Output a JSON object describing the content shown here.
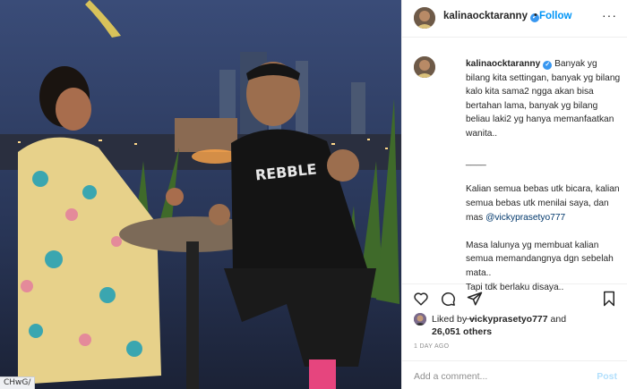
{
  "post": {
    "username": "kalinaocktaranny",
    "separator": "•",
    "follow_label": "Follow",
    "more_icon": "more-options-icon",
    "status_url": "CHwG/"
  },
  "caption": {
    "username": "kalinaocktaranny",
    "lines": [
      "Banyak yg bilang kita settingan, banyak yg bilang kalo kita sama2 ngga akan bisa bertahan lama, banyak yg bilang beliau laki2 yg hanya memanfaatkan wanita..",
      "____",
      "Kalian semua bebas utk bicara, kalian semua bebas utk menilai saya, dan mas",
      "@vickyprasetyo777",
      "Masa lalunya yg membuat kalian semua memandangnya dgn sebelah mata..",
      "Tapi tdk berlaku disaya..",
      "__"
    ]
  },
  "actions": {
    "icons": [
      "heart-icon",
      "comment-icon",
      "share-icon",
      "bookmark-icon"
    ]
  },
  "likes": {
    "prefix": "Liked by",
    "user": "vickyprasetyo777",
    "joiner": "and",
    "count": "26,051 others"
  },
  "timestamp": "1 DAY AGO",
  "comment_box": {
    "placeholder": "Add a comment...",
    "post_label": "Post"
  },
  "colors": {
    "accent": "#0095f6",
    "verified": "#3897f0",
    "mention": "#00376b",
    "post_disabled": "#b2dffc",
    "muted": "#8e8e8e"
  }
}
